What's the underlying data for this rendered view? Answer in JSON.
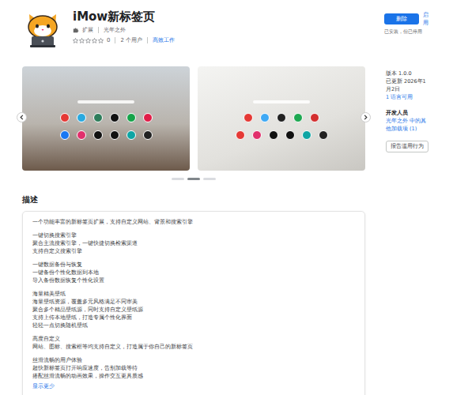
{
  "extension": {
    "name": "iMow新标签页",
    "type": "扩展",
    "publisher": "光年之外",
    "stars": 0,
    "rating_count": "0",
    "users": "2 个用户",
    "category": "高效工作"
  },
  "actions": {
    "primary": "删除",
    "secondary": "启用",
    "note": "已安装，但已停用"
  },
  "gallery": {
    "screenshots": [
      {
        "shortcuts": [
          [
            "#e53935",
            "#29a9e0",
            "#2e7d5b",
            "#111111",
            "#16a34a",
            "#e11d48"
          ],
          [
            "#1877f2",
            "#e1306c",
            "#111111",
            "#111111",
            "#0ea5a4",
            "#222222"
          ]
        ]
      },
      {
        "shortcuts": [
          [
            "#e53935",
            "#3fa9f5",
            "#222222",
            "#1da851",
            "#d32f2f"
          ],
          [
            "#e53935",
            "#e1306c",
            "#111111",
            "#111111",
            "#0ea5a4",
            "#222222"
          ]
        ]
      }
    ],
    "dots": [
      {
        "selected": false
      },
      {
        "selected": true
      },
      {
        "selected": false
      }
    ]
  },
  "details": {
    "version": "版本 1.0.0",
    "updated": "已更新 2026年1月2日",
    "languages": "1 语言可用",
    "developer_heading": "开发人员",
    "developer_link": "光年之外 中的其他加载项 (1)",
    "report": "报告滥用行为"
  },
  "description": {
    "heading": "描述",
    "paragraphs": [
      [
        "一个功能丰富的新标签页扩展，支持自定义网站、背景和搜索引擎"
      ],
      [
        "一键切换搜索引擎",
        "聚合主流搜索引擎，一键快捷切换检索渠道",
        "支持自定义搜索引擎"
      ],
      [
        "一键数据备份与恢复",
        "一键备份个性化数据到本地",
        "导入备份数据恢复个性化设置"
      ],
      [
        "海量精美壁纸",
        "海量壁纸资源，覆盖多元风格满足不同审美",
        "聚合多个精品壁纸源，同时支持自定义壁纸源",
        "支持上传本地壁纸，打造专属个性化界面",
        "轻轻一点切换随机壁纸"
      ],
      [
        "高度自定义",
        "网站、图标、搜索框等均支持自定义，打造属于你自己的新标签页"
      ],
      [
        "丝滑流畅的用户体验",
        "超快新标签页打开响应速度，告别加载等待",
        "搭配丝滑流畅的动画效果，操作交互更具质感"
      ]
    ],
    "toggle": "显示更少"
  }
}
